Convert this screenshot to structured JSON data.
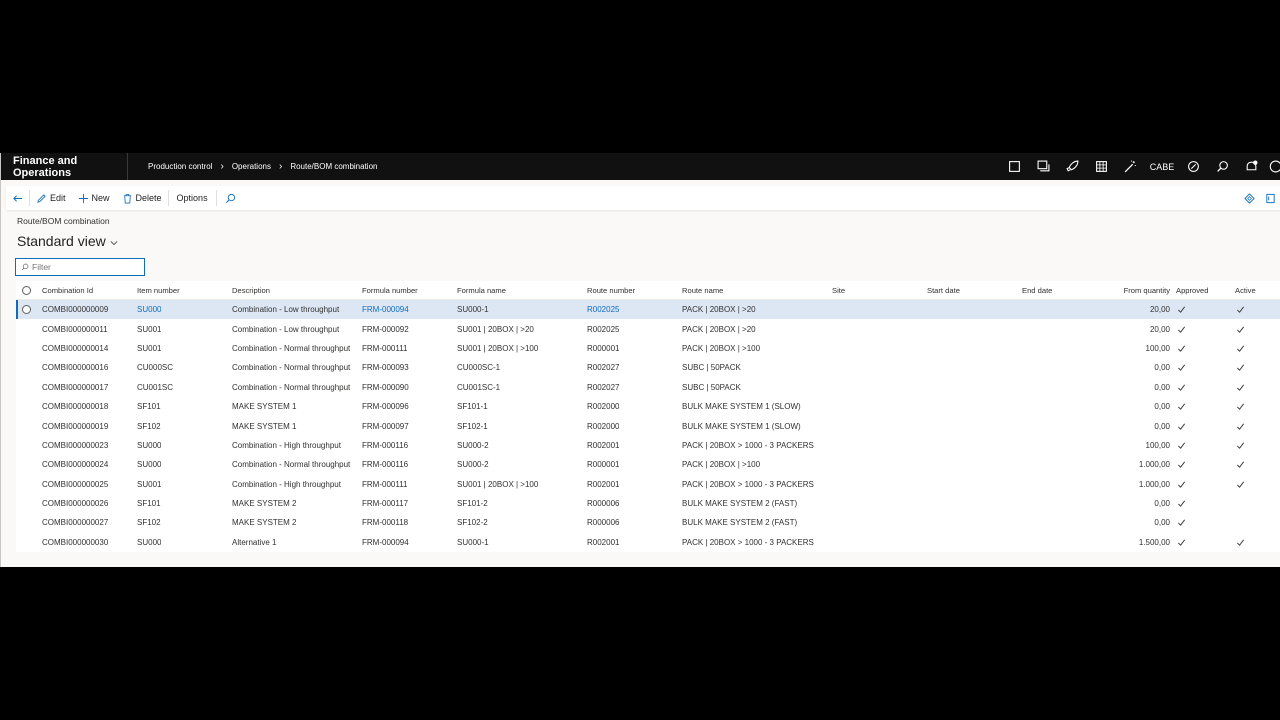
{
  "topbar": {
    "app_title": "Finance and Operations",
    "breadcrumbs": [
      "Production control",
      "Operations",
      "Route/BOM combination"
    ],
    "company": "CABE",
    "icons": [
      "square-icon",
      "copy-window-icon",
      "rocket-icon",
      "calculator-icon",
      "magic-wand-icon",
      "company-label",
      "copilot-icon",
      "search-icon",
      "notification-icon",
      "profile-icon"
    ]
  },
  "actions": {
    "edit": "Edit",
    "new": "New",
    "delete": "Delete",
    "options": "Options"
  },
  "page": {
    "caption": "Route/BOM combination",
    "view_title": "Standard view",
    "filter_placeholder": "Filter"
  },
  "columns": {
    "combination_id": "Combination Id",
    "item_number": "Item number",
    "description": "Description",
    "formula_number": "Formula number",
    "formula_name": "Formula name",
    "route_number": "Route number",
    "route_name": "Route name",
    "site": "Site",
    "start_date": "Start date",
    "end_date": "End date",
    "from_quantity": "From quantity",
    "approved": "Approved",
    "active": "Active"
  },
  "rows": [
    {
      "id": "COMBI000000009",
      "item": "SU000",
      "desc": "Combination - Low throughput",
      "fnum": "FRM-000094",
      "fname": "SU000-1",
      "rnum": "R002025",
      "rname": "PACK | 20BOX | >20",
      "qty": "20,00",
      "approved": true,
      "active": true
    },
    {
      "id": "COMBI000000011",
      "item": "SU001",
      "desc": "Combination - Low throughput",
      "fnum": "FRM-000092",
      "fname": "SU001 | 20BOX | >20",
      "rnum": "R002025",
      "rname": "PACK | 20BOX | >20",
      "qty": "20,00",
      "approved": true,
      "active": true
    },
    {
      "id": "COMBI000000014",
      "item": "SU001",
      "desc": "Combination - Normal throughput",
      "fnum": "FRM-000111",
      "fname": "SU001 | 20BOX | >100",
      "rnum": "R000001",
      "rname": "PACK | 20BOX | >100",
      "qty": "100,00",
      "approved": true,
      "active": true
    },
    {
      "id": "COMBI000000016",
      "item": "CU000SC",
      "desc": "Combination - Normal throughput",
      "fnum": "FRM-000093",
      "fname": "CU000SC-1",
      "rnum": "R002027",
      "rname": "SUBC | 50PACK",
      "qty": "0,00",
      "approved": true,
      "active": true
    },
    {
      "id": "COMBI000000017",
      "item": "CU001SC",
      "desc": "Combination - Normal throughput",
      "fnum": "FRM-000090",
      "fname": "CU001SC-1",
      "rnum": "R002027",
      "rname": "SUBC | 50PACK",
      "qty": "0,00",
      "approved": true,
      "active": true
    },
    {
      "id": "COMBI000000018",
      "item": "SF101",
      "desc": "MAKE SYSTEM 1",
      "fnum": "FRM-000096",
      "fname": "SF101-1",
      "rnum": "R002000",
      "rname": "BULK MAKE SYSTEM 1 (SLOW)",
      "qty": "0,00",
      "approved": true,
      "active": true
    },
    {
      "id": "COMBI000000019",
      "item": "SF102",
      "desc": "MAKE SYSTEM 1",
      "fnum": "FRM-000097",
      "fname": "SF102-1",
      "rnum": "R002000",
      "rname": "BULK MAKE SYSTEM 1 (SLOW)",
      "qty": "0,00",
      "approved": true,
      "active": true
    },
    {
      "id": "COMBI000000023",
      "item": "SU000",
      "desc": "Combination - High throughput",
      "fnum": "FRM-000116",
      "fname": "SU000-2",
      "rnum": "R002001",
      "rname": "PACK | 20BOX > 1000 - 3 PACKERS",
      "qty": "100,00",
      "approved": true,
      "active": true
    },
    {
      "id": "COMBI000000024",
      "item": "SU000",
      "desc": "Combination - Normal throughput",
      "fnum": "FRM-000116",
      "fname": "SU000-2",
      "rnum": "R000001",
      "rname": "PACK | 20BOX | >100",
      "qty": "1.000,00",
      "approved": true,
      "active": true
    },
    {
      "id": "COMBI000000025",
      "item": "SU001",
      "desc": "Combination - High throughput",
      "fnum": "FRM-000111",
      "fname": "SU001 | 20BOX | >100",
      "rnum": "R002001",
      "rname": "PACK | 20BOX > 1000 - 3 PACKERS",
      "qty": "1.000,00",
      "approved": true,
      "active": true
    },
    {
      "id": "COMBI000000026",
      "item": "SF101",
      "desc": "MAKE SYSTEM 2",
      "fnum": "FRM-000117",
      "fname": "SF101-2",
      "rnum": "R000006",
      "rname": "BULK MAKE SYSTEM 2 (FAST)",
      "qty": "0,00",
      "approved": true,
      "active": false
    },
    {
      "id": "COMBI000000027",
      "item": "SF102",
      "desc": "MAKE SYSTEM 2",
      "fnum": "FRM-000118",
      "fname": "SF102-2",
      "rnum": "R000006",
      "rname": "BULK MAKE SYSTEM 2 (FAST)",
      "qty": "0,00",
      "approved": true,
      "active": false
    },
    {
      "id": "COMBI000000030",
      "item": "SU000",
      "desc": "Alternative 1",
      "fnum": "FRM-000094",
      "fname": "SU000-1",
      "rnum": "R002001",
      "rname": "PACK | 20BOX > 1000 - 3 PACKERS",
      "qty": "1.500,00",
      "approved": true,
      "active": true
    }
  ],
  "colors": {
    "accent": "#0f6cbd",
    "topbar": "#111111",
    "selected_row": "#dde7f4"
  }
}
